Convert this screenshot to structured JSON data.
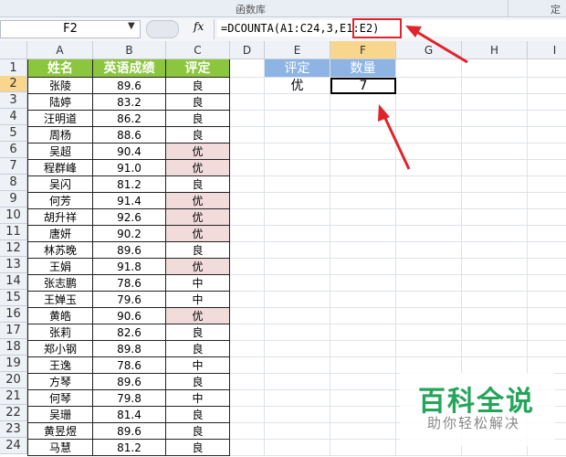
{
  "ribbon": {
    "group_label": "函数库",
    "right_label": "定"
  },
  "formula_bar": {
    "name_box": "F2",
    "fx_label": "fx",
    "formula": "=DCOUNTA(A1:C24,3,E1:E2)"
  },
  "columns": [
    "A",
    "B",
    "C",
    "D",
    "E",
    "F",
    "G",
    "H",
    "I"
  ],
  "rows": [
    "1",
    "2",
    "3",
    "4",
    "5",
    "6",
    "7",
    "8",
    "9",
    "10",
    "11",
    "12",
    "13",
    "14",
    "15",
    "16",
    "17",
    "18",
    "19",
    "20",
    "21",
    "22",
    "23",
    "24"
  ],
  "table": {
    "headers": [
      "姓名",
      "英语成绩",
      "评定"
    ],
    "data": [
      [
        "张陵",
        "89.6",
        "良"
      ],
      [
        "陆婷",
        "83.2",
        "良"
      ],
      [
        "汪明道",
        "86.2",
        "良"
      ],
      [
        "周杨",
        "88.6",
        "良"
      ],
      [
        "吴超",
        "90.4",
        "优"
      ],
      [
        "程群峰",
        "91.0",
        "优"
      ],
      [
        "吴闪",
        "81.2",
        "良"
      ],
      [
        "何芳",
        "91.4",
        "优"
      ],
      [
        "胡升祥",
        "92.6",
        "优"
      ],
      [
        "唐妍",
        "90.2",
        "优"
      ],
      [
        "林苏晚",
        "89.6",
        "良"
      ],
      [
        "王娟",
        "91.8",
        "优"
      ],
      [
        "张志鹏",
        "78.6",
        "中"
      ],
      [
        "王婵玉",
        "79.6",
        "中"
      ],
      [
        "黄皓",
        "90.6",
        "优"
      ],
      [
        "张莉",
        "82.6",
        "良"
      ],
      [
        "郑小钢",
        "89.8",
        "良"
      ],
      [
        "王逸",
        "78.6",
        "中"
      ],
      [
        "方琴",
        "89.6",
        "良"
      ],
      [
        "何琴",
        "79.8",
        "中"
      ],
      [
        "吴珊",
        "81.4",
        "良"
      ],
      [
        "黄昱煜",
        "89.6",
        "良"
      ],
      [
        "马慧",
        "81.2",
        "良"
      ]
    ]
  },
  "criteria": {
    "header": "评定",
    "value": "优"
  },
  "result": {
    "header": "数量",
    "value": "7"
  },
  "watermark": {
    "main": "百科全说",
    "sub": "助你轻松解决"
  }
}
